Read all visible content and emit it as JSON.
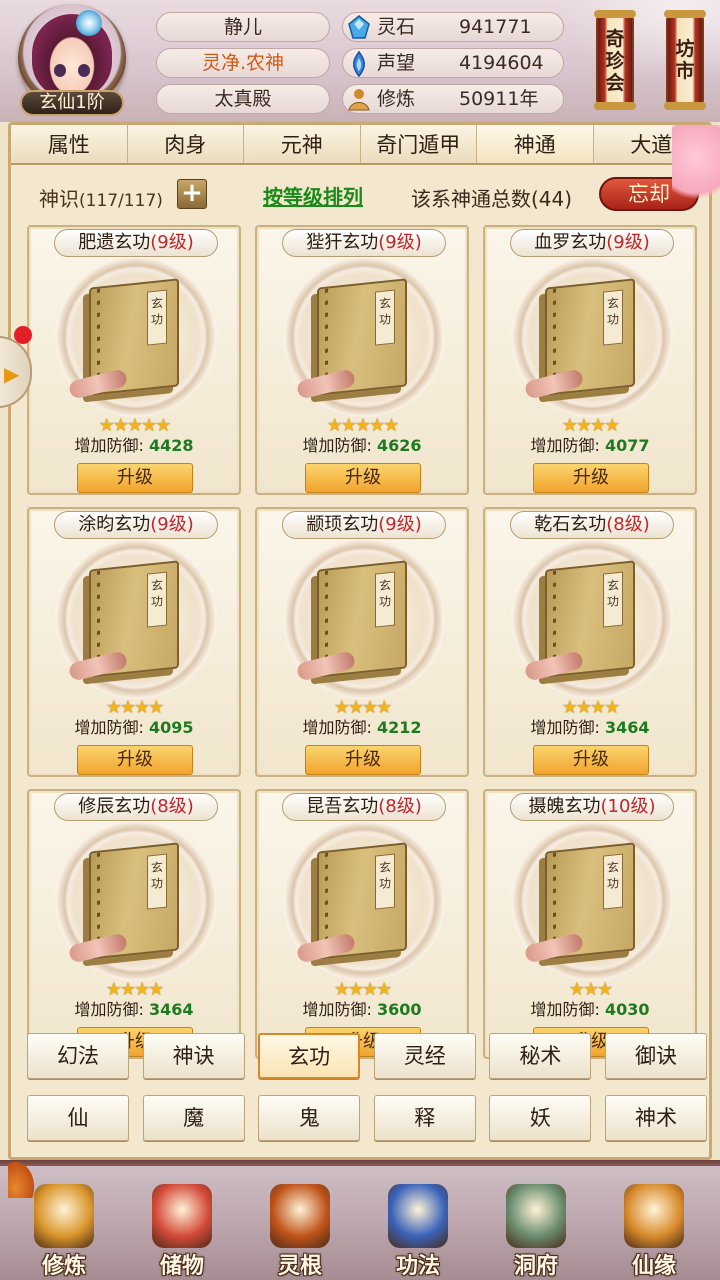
{
  "player": {
    "rank": "玄仙1阶",
    "name": "静儿",
    "title": "灵净.农神",
    "location": "太真殿"
  },
  "stats": [
    {
      "icon": "spirit-stone-icon",
      "label": "灵石",
      "value": "941771"
    },
    {
      "icon": "reputation-icon",
      "label": "声望",
      "value": "4194604"
    },
    {
      "icon": "cultivation-icon",
      "label": "修炼",
      "value": "50911年"
    }
  ],
  "top_buttons": {
    "treasure_label": "奇珍会",
    "market_label": "坊市"
  },
  "tabs": [
    {
      "label": "属性"
    },
    {
      "label": "肉身"
    },
    {
      "label": "元神"
    },
    {
      "label": "奇门遁甲"
    },
    {
      "label": "神通",
      "active": true
    },
    {
      "label": "大道"
    }
  ],
  "toolbar": {
    "sense_label": "神识",
    "sense_value": "(117/117)",
    "plus_label": "+",
    "sort_label": "按等级排列",
    "total_label": "该系神通总数(44)",
    "forget_label": "忘却"
  },
  "skill_cards": [
    {
      "name": "肥遗玄功",
      "level": "(9级)",
      "stars": "★★★★★",
      "stat_label": "增加防御:",
      "stat_value": "4428",
      "button": "升级",
      "book_label": "玄功"
    },
    {
      "name": "狴犴玄功",
      "level": "(9级)",
      "stars": "★★★★★",
      "stat_label": "增加防御:",
      "stat_value": "4626",
      "button": "升级",
      "book_label": "玄功"
    },
    {
      "name": "血罗玄功",
      "level": "(9级)",
      "stars": "★★★★",
      "stat_label": "增加防御:",
      "stat_value": "4077",
      "button": "升级",
      "book_label": "玄功"
    },
    {
      "name": "涂昀玄功",
      "level": "(9级)",
      "stars": "★★★★",
      "stat_label": "增加防御:",
      "stat_value": "4095",
      "button": "升级",
      "book_label": "玄功"
    },
    {
      "name": "颛顼玄功",
      "level": "(9级)",
      "stars": "★★★★",
      "stat_label": "增加防御:",
      "stat_value": "4212",
      "button": "升级",
      "book_label": "玄功"
    },
    {
      "name": "乾石玄功",
      "level": "(8级)",
      "stars": "★★★★",
      "stat_label": "增加防御:",
      "stat_value": "3464",
      "button": "升级",
      "book_label": "玄功"
    },
    {
      "name": "修辰玄功",
      "level": "(8级)",
      "stars": "★★★★",
      "stat_label": "增加防御:",
      "stat_value": "3464",
      "button": "升级",
      "book_label": "玄功"
    },
    {
      "name": "昆吾玄功",
      "level": "(8级)",
      "stars": "★★★★",
      "stat_label": "增加防御:",
      "stat_value": "3600",
      "button": "升级",
      "book_label": "玄功"
    },
    {
      "name": "摄魄玄功",
      "level": "(10级)",
      "stars": "★★★",
      "stat_label": "增加防御:",
      "stat_value": "4030",
      "button": "升级",
      "book_label": "玄功"
    }
  ],
  "categories_row1": [
    {
      "label": "幻法"
    },
    {
      "label": "神诀"
    },
    {
      "label": "玄功",
      "active": true
    },
    {
      "label": "灵经"
    },
    {
      "label": "秘术"
    },
    {
      "label": "御诀"
    }
  ],
  "categories_row2": [
    {
      "label": "仙"
    },
    {
      "label": "魔"
    },
    {
      "label": "鬼"
    },
    {
      "label": "释"
    },
    {
      "label": "妖"
    },
    {
      "label": "神术"
    }
  ],
  "bottom_nav": [
    {
      "label": "修炼",
      "icon": "cultivate-icon",
      "color": "#d9962c"
    },
    {
      "label": "储物",
      "icon": "storage-bag-icon",
      "color": "#d44b3a"
    },
    {
      "label": "灵根",
      "icon": "spirit-root-icon",
      "color": "#c0541a"
    },
    {
      "label": "功法",
      "icon": "skill-book-icon",
      "color": "#3a63b8"
    },
    {
      "label": "洞府",
      "icon": "cave-mansion-icon",
      "color": "#6a8c6e"
    },
    {
      "label": "仙缘",
      "icon": "gourd-icon",
      "color": "#d88b2c"
    }
  ],
  "colors": {
    "level_red": "#c0262a",
    "value_green": "#1e7a1e",
    "sort_green": "#1a8a1a",
    "upgrade_button": "#f1a42d",
    "forget_button": "#a8231a"
  }
}
